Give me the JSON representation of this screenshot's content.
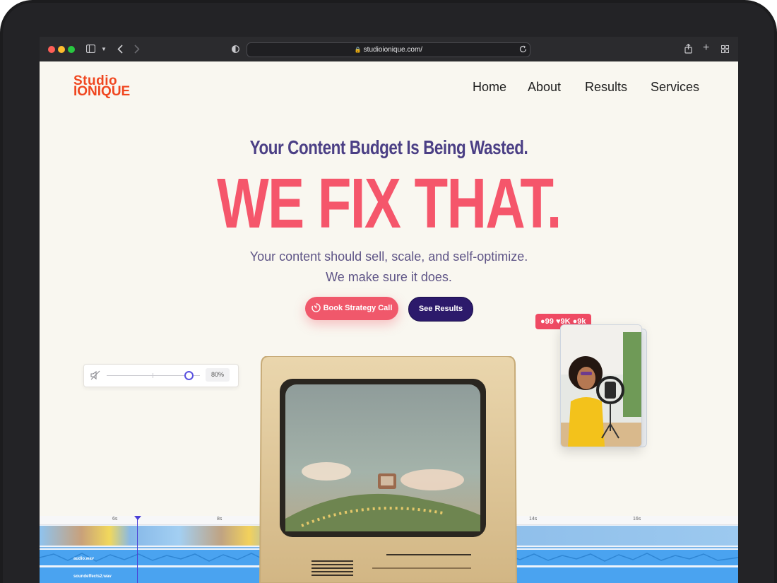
{
  "browser": {
    "url": "studioionique.com/",
    "colors": {
      "close": "#ff5f57",
      "minimize": "#febc2e",
      "maximize": "#28c840"
    }
  },
  "brand": {
    "line1": "Studio",
    "line2": "IONIQUE",
    "color": "#f0461f"
  },
  "nav": {
    "items": [
      "Home",
      "About",
      "Results",
      "Services"
    ]
  },
  "hero": {
    "kicker": "Your Content Budget Is Being Wasted.",
    "headline": "WE FIX THAT.",
    "sub_line1": "Your content should sell, scale, and self-optimize.",
    "sub_line2": "We make sure it does.",
    "primary_cta": "Book Strategy Call",
    "secondary_cta": "See Results",
    "colors": {
      "kicker": "#4b3f85",
      "headline": "#f5566b",
      "primary": "#f0586b",
      "secondary": "#2c1a6b"
    }
  },
  "volume_widget": {
    "value_label": "80%",
    "level": 0.8,
    "icon": "speaker-muted-icon"
  },
  "social_badge": {
    "comments": "99",
    "likes": "9K",
    "followers": "9k"
  },
  "timeline": {
    "ticks": [
      "6s",
      "8s",
      "14s",
      "16s"
    ],
    "tracks": [
      "audio.wav",
      "soundeffects2.wav"
    ]
  }
}
